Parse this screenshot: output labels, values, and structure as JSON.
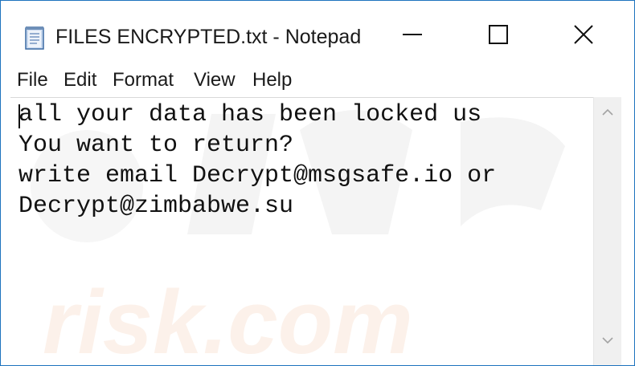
{
  "window": {
    "title": "FILES ENCRYPTED.txt - Notepad"
  },
  "icons": {
    "app": "notepad-icon",
    "minimize": "minimize-icon",
    "maximize": "maximize-icon",
    "close": "close-icon",
    "scroll_up": "chevron-up-icon",
    "scroll_down": "chevron-down-icon"
  },
  "menu": {
    "file": "File",
    "edit": "Edit",
    "format": "Format",
    "view": "View",
    "help": "Help"
  },
  "document": {
    "lines": [
      "all your data has been locked us",
      "You want to return?",
      "write email Decrypt@msgsafe.io or",
      "Decrypt@zimbabwe.su"
    ]
  },
  "watermark": {
    "text": "risk.com"
  }
}
